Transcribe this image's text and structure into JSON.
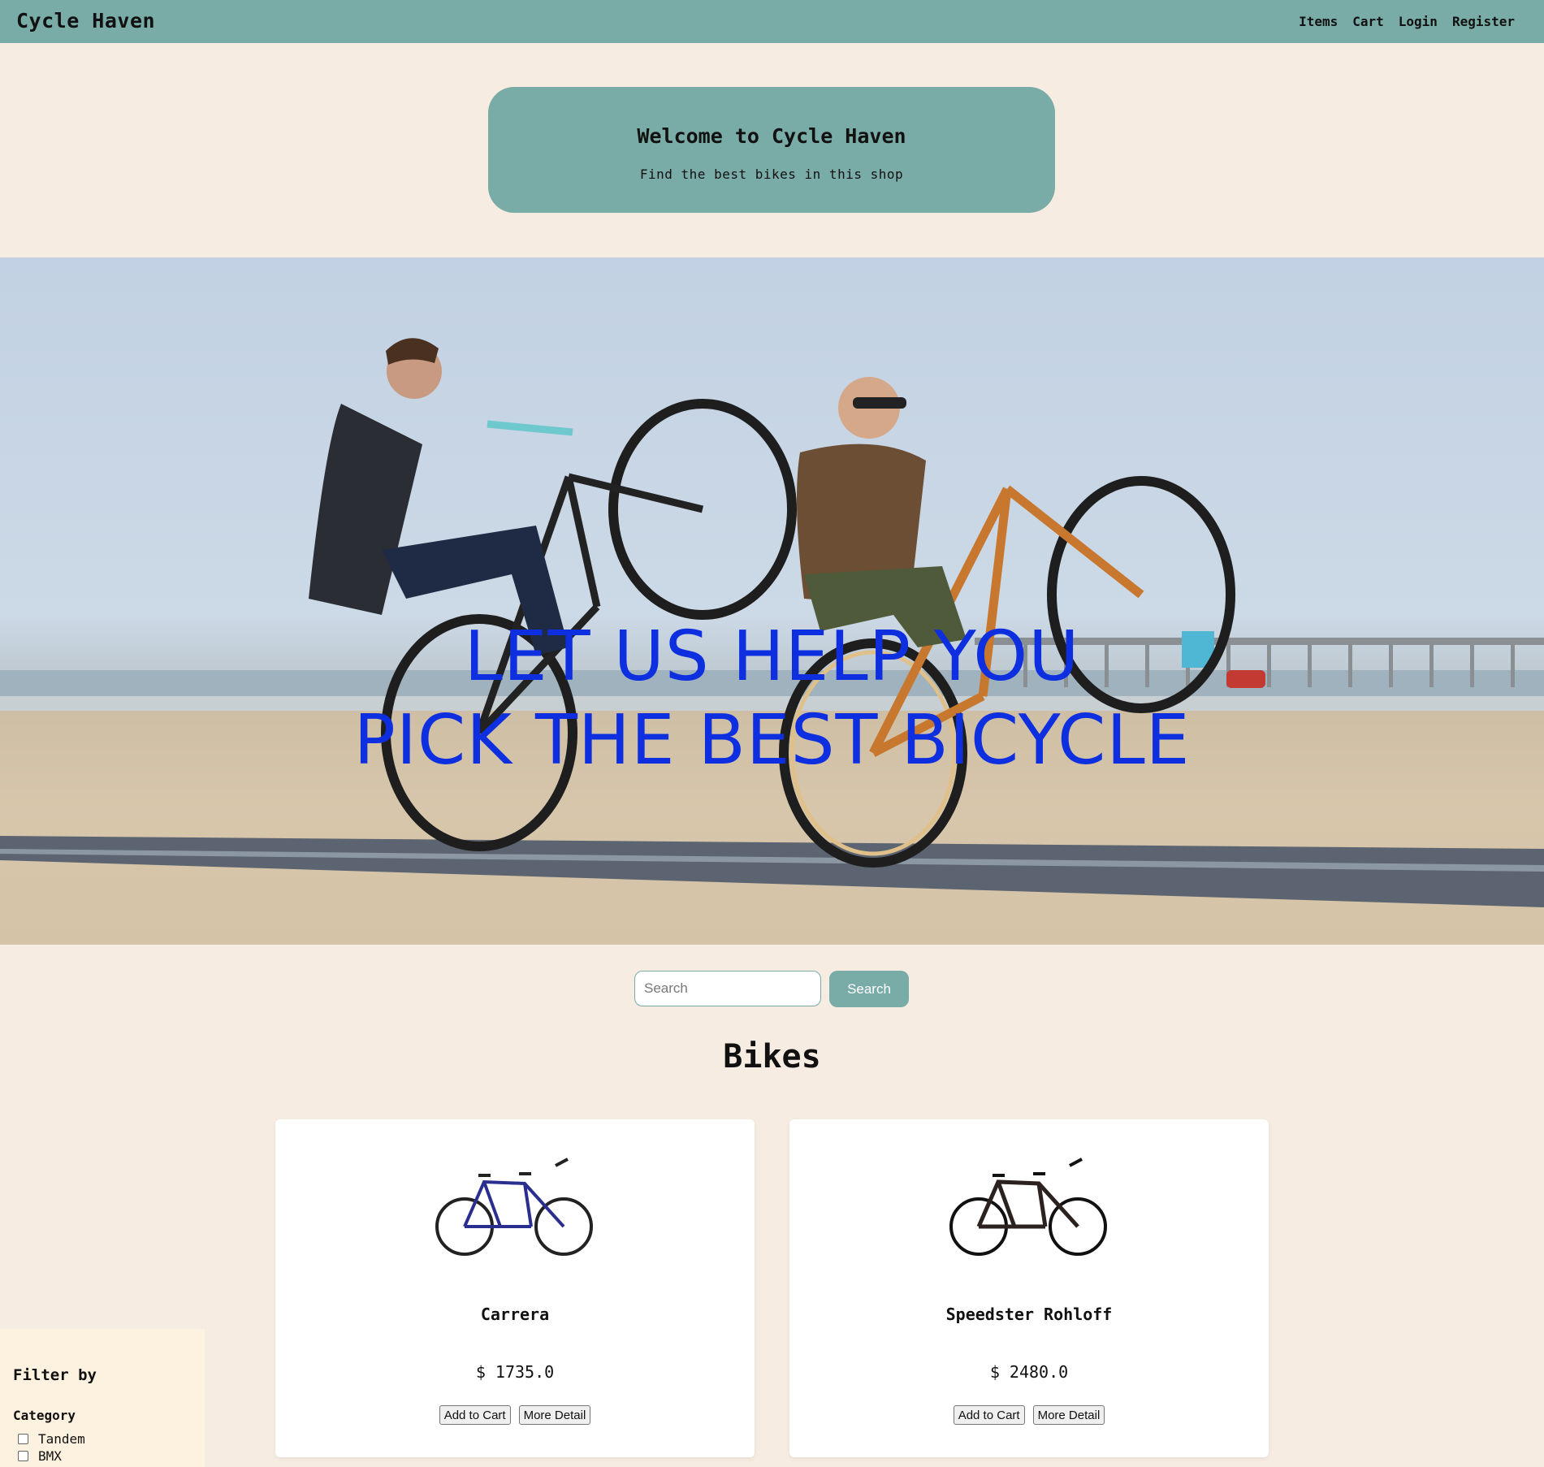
{
  "navbar": {
    "brand": "Cycle Haven",
    "links": [
      "Items",
      "Cart",
      "Login",
      "Register"
    ]
  },
  "welcome": {
    "title": "Welcome to Cycle Haven",
    "subtitle": "Find the best bikes in this shop"
  },
  "hero": {
    "line1": "LET US HELP YOU",
    "line2": "PICK THE BEST BICYCLE",
    "text_color": "#0d2fe0"
  },
  "search": {
    "placeholder": "Search",
    "button_label": "Search"
  },
  "section_title": "Bikes",
  "products": [
    {
      "name": "Carrera",
      "price": "$ 1735.0",
      "add_label": "Add to Cart",
      "detail_label": "More Detail",
      "frame_color": "#2a2f8f"
    },
    {
      "name": "Speedster Rohloff",
      "price": "$ 2480.0",
      "add_label": "Add to Cart",
      "detail_label": "More Detail",
      "frame_color": "#2b2220"
    }
  ],
  "filter": {
    "title": "Filter by",
    "category_label": "Category",
    "options": [
      "Tandem",
      "BMX"
    ]
  },
  "colors": {
    "accent": "#79aba7",
    "background": "#f7ece1",
    "filter_bg": "#fdf1df"
  }
}
